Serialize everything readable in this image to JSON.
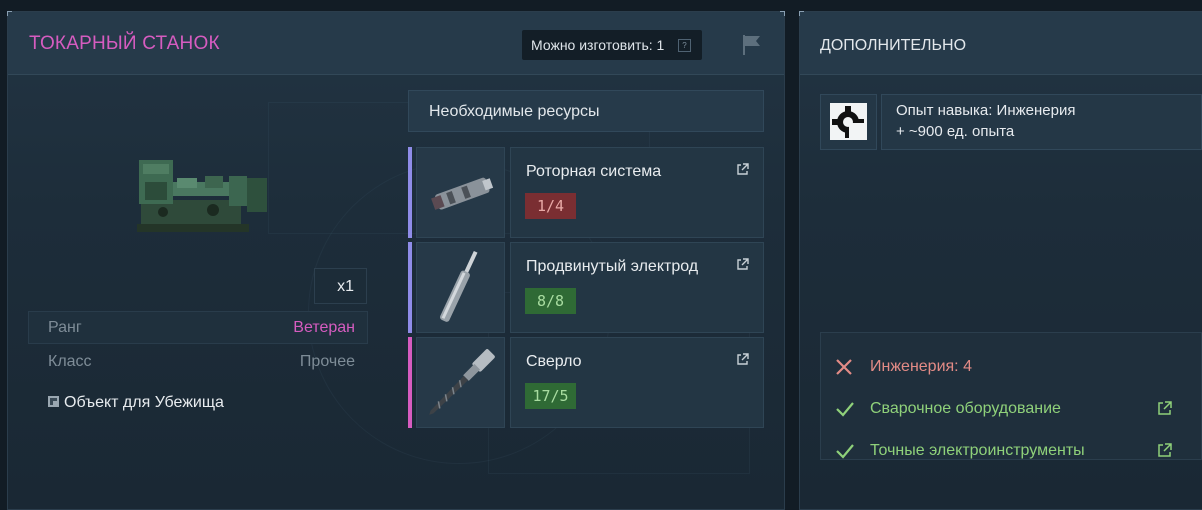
{
  "left": {
    "title": "ТОКАРНЫЙ СТАНОК",
    "craftable_label": "Можно изготовить: 1",
    "help_mark": "?",
    "quantity": "x1",
    "stats": [
      {
        "key": "Ранг",
        "value": "Ветеран",
        "color": "#d65cc0"
      },
      {
        "key": "Класс",
        "value": "Прочее",
        "color": "#7e8c97"
      }
    ],
    "shelter_label": "Объект для Убежища",
    "resources_header": "Необходимые ресурсы",
    "resources": [
      {
        "name": "Роторная система",
        "count": "1/4",
        "status": "insufficient",
        "accent": "#8f8ce8",
        "icon": "rotor-system-icon"
      },
      {
        "name": "Продвинутый электрод",
        "count": "8/8",
        "status": "sufficient",
        "accent": "#8f8ce8",
        "icon": "electrode-icon"
      },
      {
        "name": "Сверло",
        "count": "17/5",
        "status": "sufficient",
        "accent": "#d65cc0",
        "icon": "drill-bit-icon"
      }
    ]
  },
  "right": {
    "title": "ДОПОЛНИТЕЛЬНО",
    "xp_line1": "Опыт навыка: Инженерия",
    "xp_line2": "+ ~900 ед. опыта",
    "requirements": [
      {
        "text": "Инженерия: 4",
        "met": false,
        "link": false
      },
      {
        "text": "Сварочное оборудование",
        "met": true,
        "link": true
      },
      {
        "text": "Точные электроинструменты",
        "met": true,
        "link": true
      }
    ]
  },
  "colors": {
    "accent_pink": "#d65cc0",
    "ok_green": "#8fd17a",
    "fail_red": "#e38b86",
    "count_bad_bg": "#7a2e32",
    "count_ok_bg": "#2f6a35"
  }
}
